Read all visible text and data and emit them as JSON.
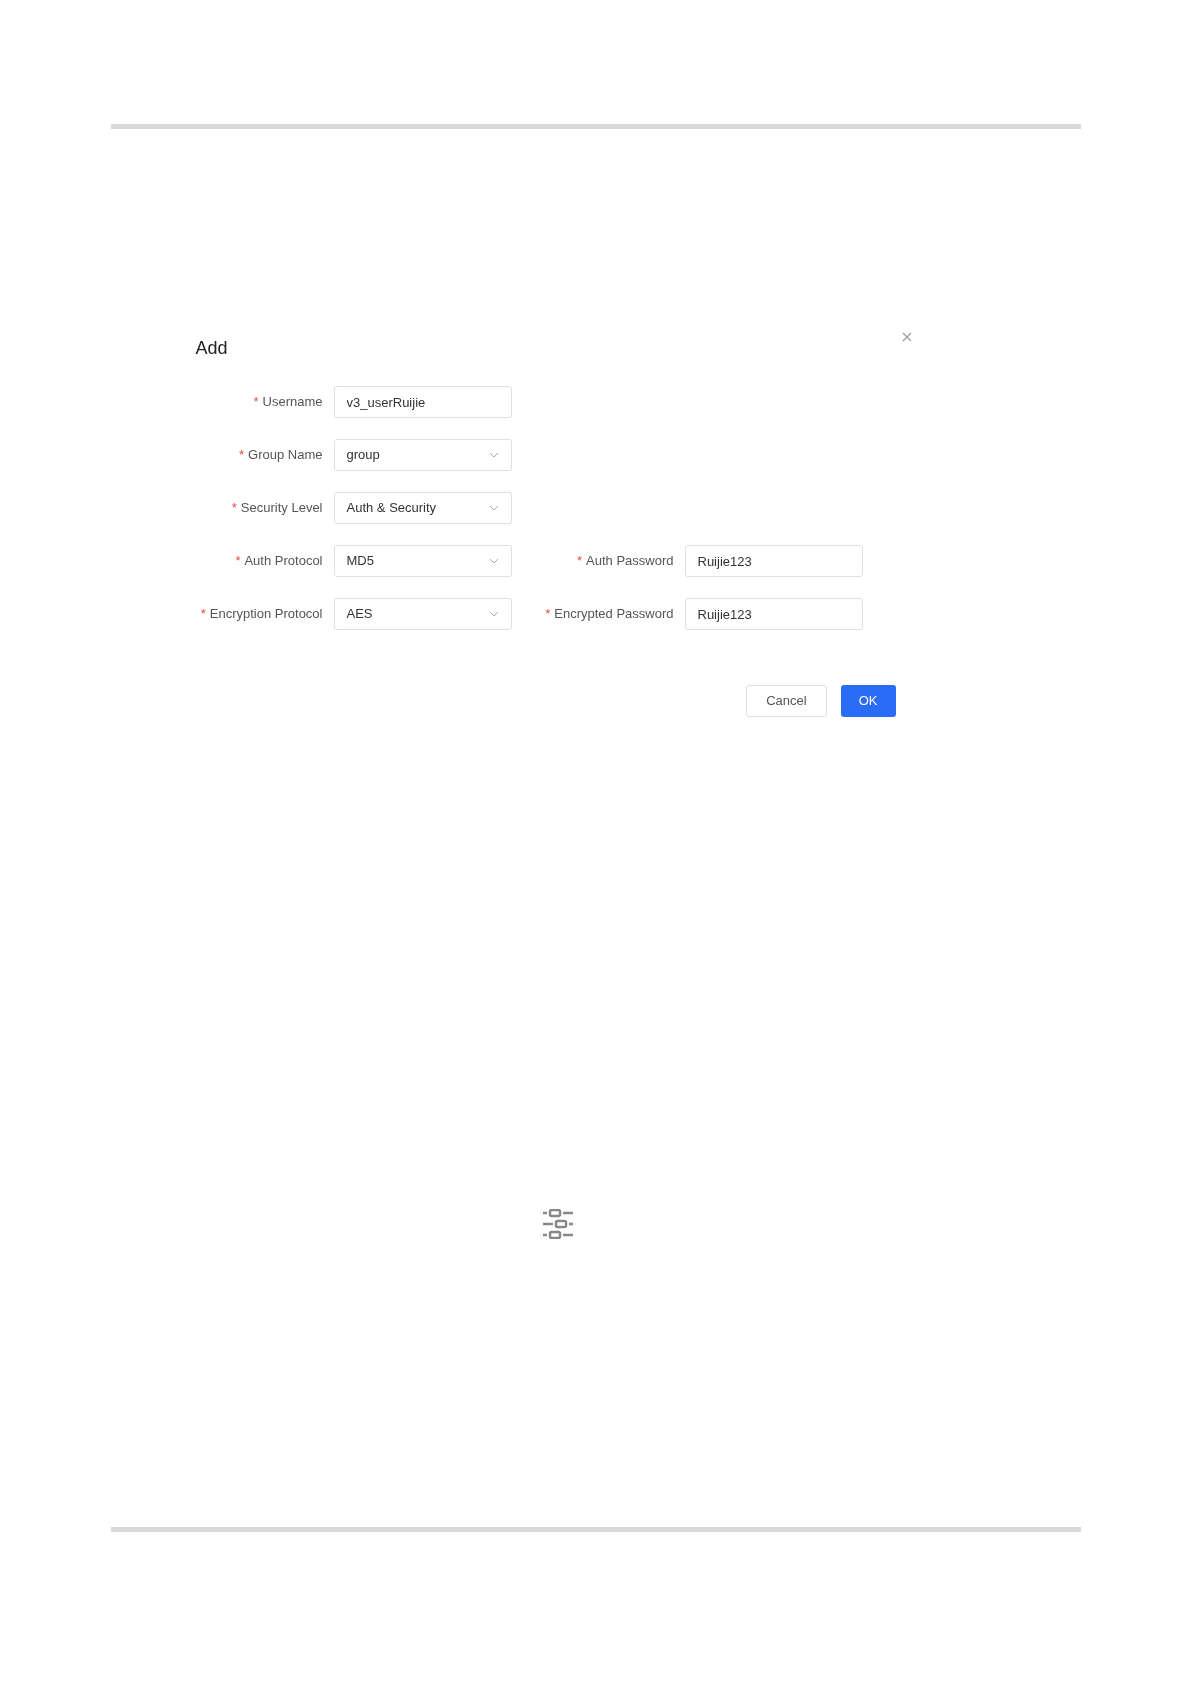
{
  "dialog": {
    "title": "Add",
    "rows": [
      [
        {
          "label": "Username",
          "required_mark": "*",
          "kind": "text",
          "value": "v3_userRuijie"
        }
      ],
      [
        {
          "label": "Group Name",
          "required_mark": "*",
          "kind": "select",
          "value": "group"
        }
      ],
      [
        {
          "label": "Security Level",
          "required_mark": "*",
          "kind": "select",
          "value": "Auth & Security"
        }
      ],
      [
        {
          "label": "Auth Protocol",
          "required_mark": "*",
          "kind": "select",
          "value": "MD5"
        },
        {
          "label": "Auth Password",
          "required_mark": "*",
          "kind": "text",
          "value": "Ruijie123"
        }
      ],
      [
        {
          "label": "Encryption Protocol",
          "required_mark": "*",
          "kind": "select",
          "value": "AES"
        },
        {
          "label": "Encrypted Password",
          "required_mark": "*",
          "kind": "text",
          "value": "Ruijie123"
        }
      ]
    ],
    "buttons": [
      {
        "label": "Cancel",
        "kind": "secondary"
      },
      {
        "label": "OK",
        "kind": "primary"
      }
    ]
  }
}
